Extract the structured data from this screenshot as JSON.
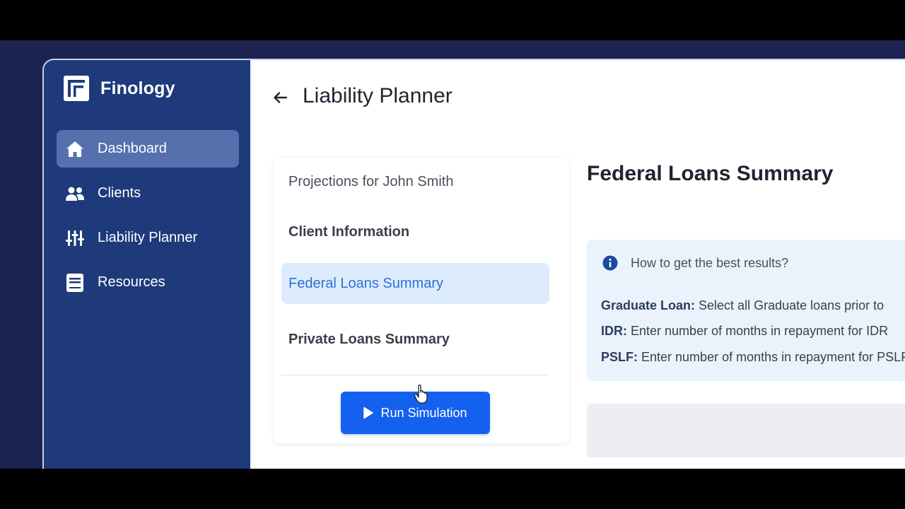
{
  "brand": {
    "name": "Finology",
    "icon": "finology-logo"
  },
  "sidebar": {
    "items": [
      {
        "label": "Dashboard",
        "icon": "home-icon",
        "active": true
      },
      {
        "label": "Clients",
        "icon": "users-icon",
        "active": false
      },
      {
        "label": "Liability Planner",
        "icon": "sliders-icon",
        "active": false
      },
      {
        "label": "Resources",
        "icon": "document-icon",
        "active": false
      }
    ]
  },
  "header": {
    "title": "Liability Planner",
    "back_icon": "arrow-left-icon"
  },
  "panel": {
    "heading": "Projections for John Smith",
    "steps": [
      {
        "label": "Client Information"
      },
      {
        "label": "Federal Loans Summary",
        "selected": true
      },
      {
        "label": "Private Loans Summary"
      }
    ],
    "run_button": "Run Simulation"
  },
  "content": {
    "title": "Federal Loans Summary",
    "tips": {
      "heading": "How to get the best results?",
      "lines": [
        {
          "label": "Graduate Loan:",
          "text": "Select all Graduate loans prior to"
        },
        {
          "label": "IDR:",
          "text": "Enter number of months in repayment for IDR"
        },
        {
          "label": "PSLF:",
          "text": "Enter number of months in repayment for PSLF"
        }
      ]
    }
  },
  "colors": {
    "sidebar": "#1e3a7a",
    "sidebar_active": "#5570ad",
    "primary": "#1461f0",
    "selected_step": "#dcecfc",
    "selected_step_text": "#2f6fd6",
    "tips_bg": "#eaf3fc"
  }
}
